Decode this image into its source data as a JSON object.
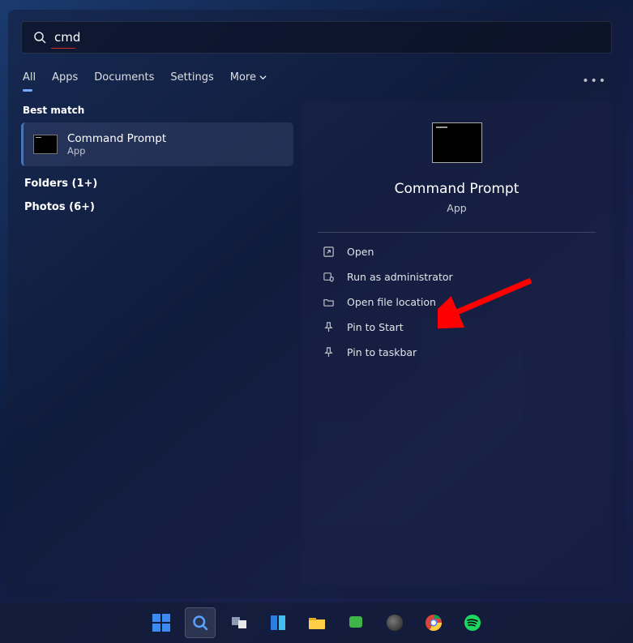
{
  "search": {
    "value": "cmd"
  },
  "tabs": {
    "all": "All",
    "apps": "Apps",
    "documents": "Documents",
    "settings": "Settings",
    "more": "More"
  },
  "results": {
    "best_label": "Best match",
    "best": {
      "title": "Command Prompt",
      "sub": "App"
    },
    "categories": [
      {
        "label": "Folders (1+)"
      },
      {
        "label": "Photos (6+)"
      }
    ]
  },
  "detail": {
    "title": "Command Prompt",
    "sub": "App",
    "actions": {
      "open": "Open",
      "run_admin": "Run as administrator",
      "open_loc": "Open file location",
      "pin_start": "Pin to Start",
      "pin_taskbar": "Pin to taskbar"
    }
  },
  "taskbar_icons": [
    "start",
    "search",
    "taskview",
    "widgets",
    "explorer",
    "phone",
    "obs",
    "chrome",
    "spotify"
  ]
}
